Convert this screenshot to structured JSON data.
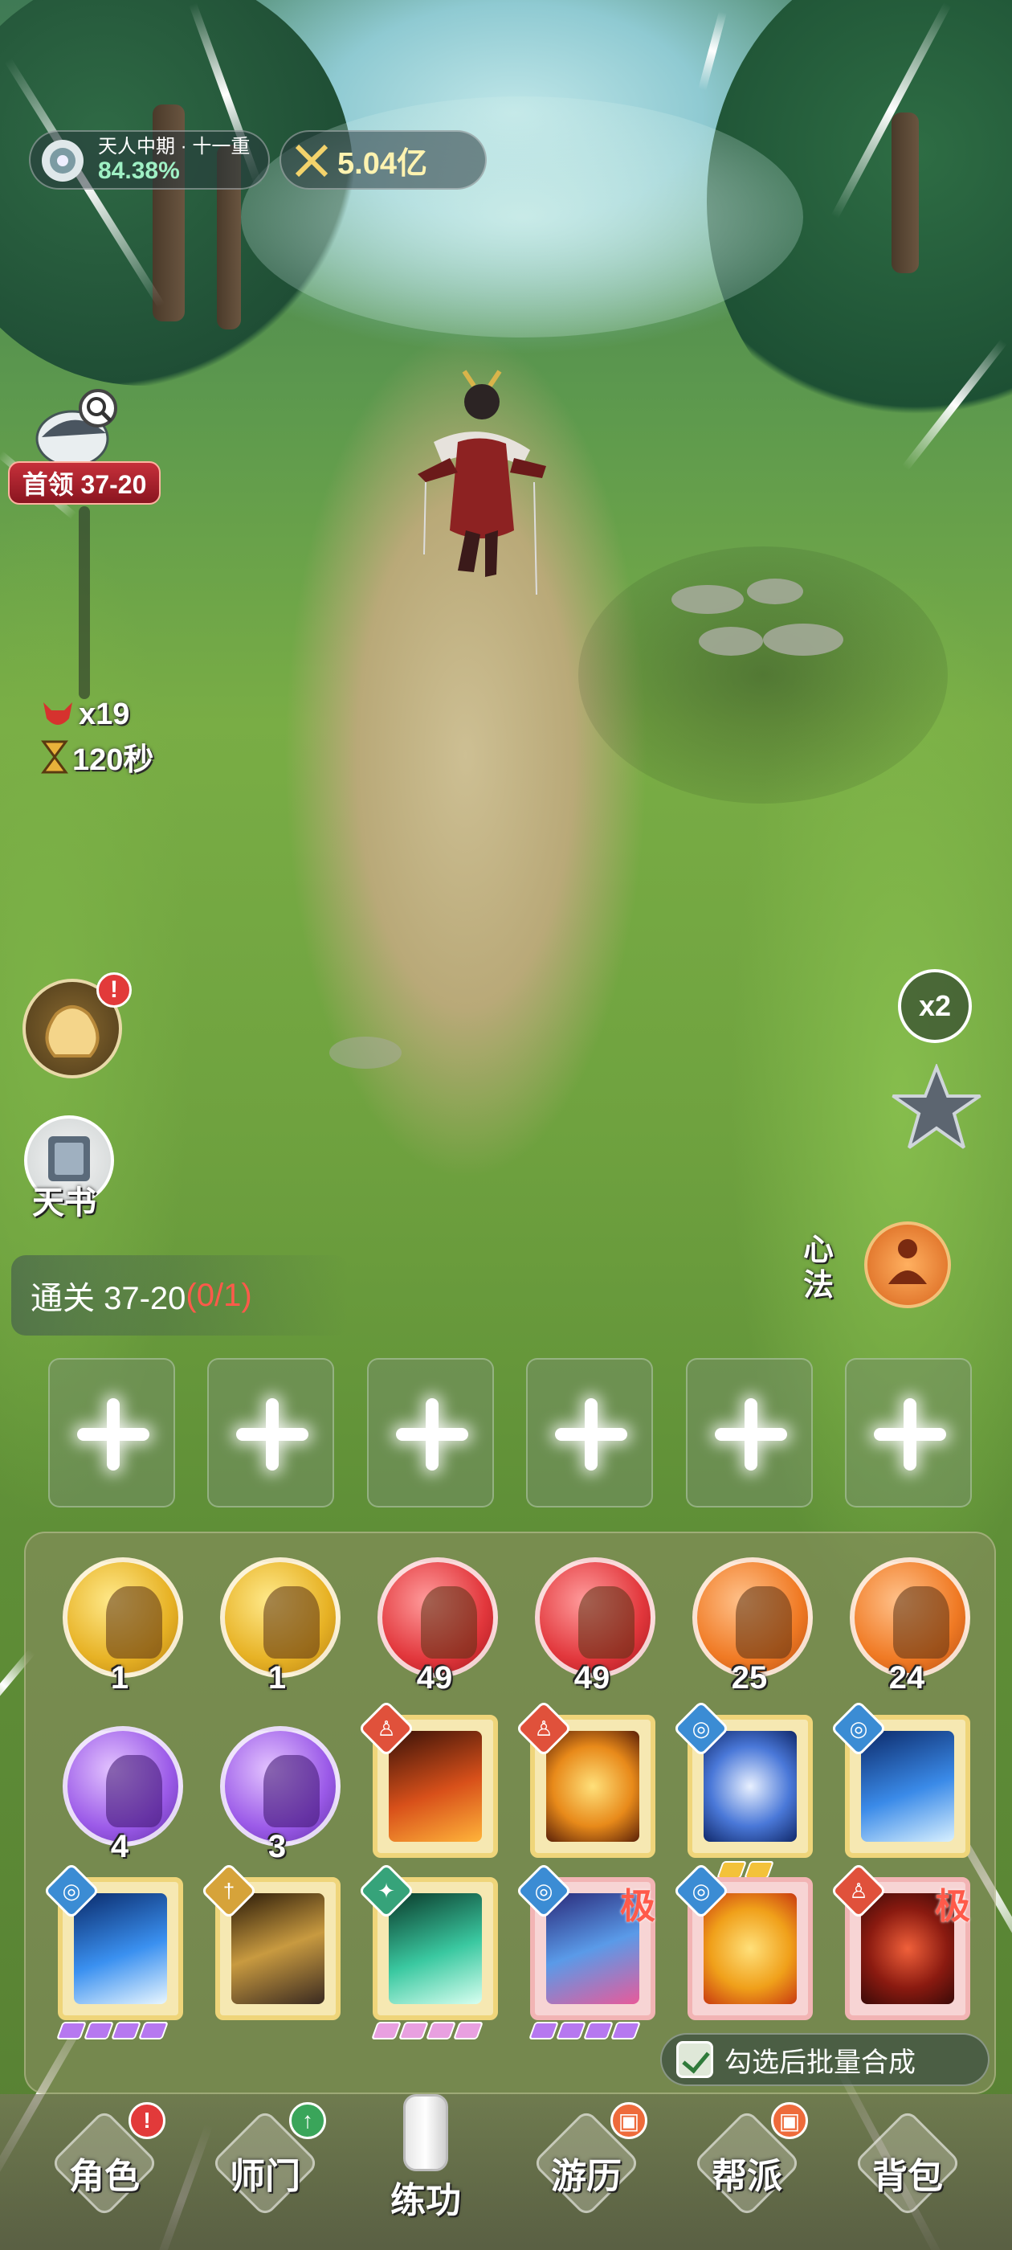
{
  "hud": {
    "realm_name": "天人中期 · 十一重",
    "realm_progress": "84.38%",
    "power": "5.04亿"
  },
  "boss": {
    "tag": "首领 37-20",
    "kills": "x19",
    "timer": "120秒"
  },
  "side": {
    "book_label": "天书",
    "speed_label": "x2",
    "bag_badge": "!",
    "xinfa_label": "心法"
  },
  "stage": {
    "label": "通关 37-20",
    "progress": "(0/1)"
  },
  "items_row1": [
    {
      "color": "gold",
      "count": "1"
    },
    {
      "color": "gold",
      "count": "1"
    },
    {
      "color": "red",
      "count": "49"
    },
    {
      "color": "red",
      "count": "49"
    },
    {
      "color": "orange",
      "count": "25"
    },
    {
      "color": "orange",
      "count": "24"
    }
  ],
  "items_row2_orbs": [
    {
      "color": "purple",
      "count": "4"
    },
    {
      "color": "purple",
      "count": "3"
    }
  ],
  "merge": {
    "label": "勾选后批量合成",
    "checked": true
  },
  "card_marks": {
    "ji": "极"
  },
  "nav": {
    "items": [
      {
        "label": "角色",
        "badge": "!"
      },
      {
        "label": "师门",
        "badge": "↑"
      },
      {
        "label": "练功",
        "badge": ""
      },
      {
        "label": "游历",
        "badge": "▣"
      },
      {
        "label": "帮派",
        "badge": "▣"
      },
      {
        "label": "背包",
        "badge": ""
      }
    ]
  }
}
